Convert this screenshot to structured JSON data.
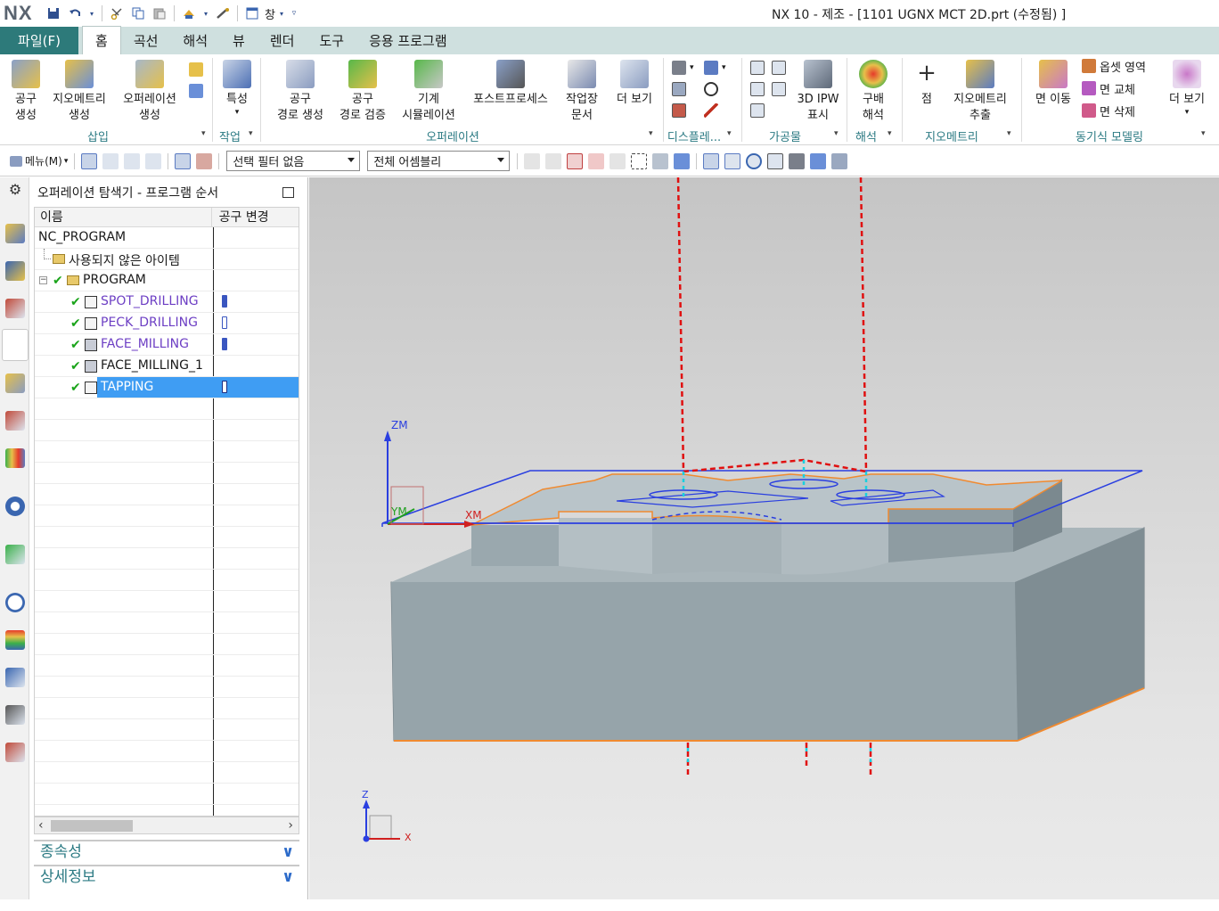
{
  "titlebar": {
    "logo": "NX",
    "window_menu": "창",
    "title": "NX 10 - 제조 - [1101 UGNX MCT 2D.prt (수정됨) ]"
  },
  "menu": {
    "file": "파일(F)",
    "tabs": [
      "홈",
      "곡선",
      "해석",
      "뷰",
      "렌더",
      "도구",
      "응용 프로그램"
    ]
  },
  "ribbon": {
    "insert": {
      "create_tool": "공구\n생성",
      "create_geometry": "지오메트리\n생성",
      "create_operation": "오퍼레이션\n생성",
      "label": "삽입"
    },
    "work": {
      "properties": "특성",
      "label": "작업"
    },
    "operation": {
      "generate_toolpath": "공구\n경로 생성",
      "verify_toolpath": "공구\n경로 검증",
      "machine_sim": "기계\n시뮬레이션",
      "postprocess": "포스트프로세스",
      "shop_doc": "작업장\n문서",
      "more": "더 보기",
      "label": "오퍼레이션"
    },
    "display": {
      "label": "디스플레..."
    },
    "workpiece": {
      "ipw": "3D IPW\n표시",
      "label": "가공물"
    },
    "analysis": {
      "gradient": "구배\n해석",
      "label": "해석"
    },
    "geometry": {
      "point": "점",
      "extract": "지오메트리\n추출",
      "label": "지오메트리"
    },
    "sync": {
      "move_face": "면 이동",
      "offset_region": "옵셋 영역",
      "replace_face": "면 교체",
      "delete_face": "면 삭제",
      "more": "더 보기",
      "label": "동기식 모델링"
    }
  },
  "toolbar": {
    "menu": "메뉴(M)",
    "selection_filter": "선택 필터 없음",
    "scope": "전체 어셈블리"
  },
  "navigator": {
    "title": "오퍼레이션 탐색기 - 프로그램 순서",
    "col_name": "이름",
    "col_tool_change": "공구 변경",
    "root": "NC_PROGRAM",
    "unused": "사용되지 않은 아이템",
    "program": "PROGRAM",
    "operations": [
      {
        "name": "SPOT_DRILLING",
        "tool_change": true
      },
      {
        "name": "PECK_DRILLING",
        "tool_change": true
      },
      {
        "name": "FACE_MILLING",
        "tool_change": true
      },
      {
        "name": "FACE_MILLING_1",
        "tool_change": false
      },
      {
        "name": "TAPPING",
        "tool_change": true
      }
    ],
    "dependencies": "종속성",
    "details": "상세정보"
  },
  "viewport": {
    "axis_zm": "ZM",
    "axis_ym": "YM",
    "axis_xm": "XM",
    "triad_z": "Z",
    "triad_x": "X"
  },
  "colors": {
    "file_tab": "#2d7a7a",
    "selection": "#3f9df3",
    "operation_text": "#6d3fc4",
    "toolpath_red": "#e01010",
    "blank_blue": "#2a3fe0"
  }
}
